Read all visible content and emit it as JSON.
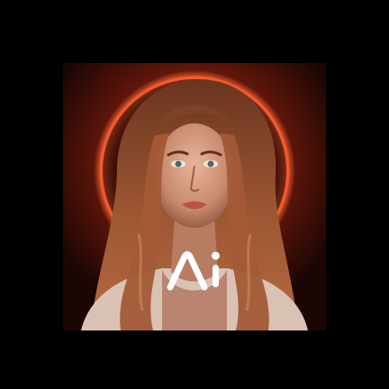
{
  "app_icon": {
    "portrait_subject": "woman-portrait",
    "logo_text": "Ai",
    "colors": {
      "page_background": "#000000",
      "icon_background": "#1a0604",
      "glow_ring": "#d8401e",
      "hair": "#8a4a2c",
      "skin": "#d49a80",
      "logo": "#ffffff"
    }
  }
}
